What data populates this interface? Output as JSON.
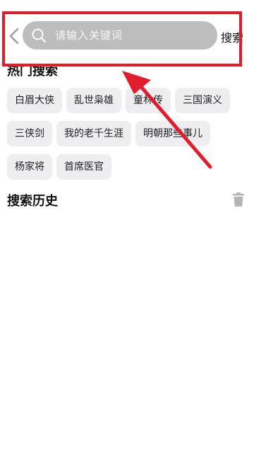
{
  "search": {
    "placeholder": "请输入关键词",
    "button_label": "搜索"
  },
  "hot": {
    "title": "热门搜索",
    "tags": [
      "白眉大侠",
      "乱世枭雄",
      "童林传",
      "三国演义",
      "三侠剑",
      "我的老千生涯",
      "明朝那些事儿",
      "杨家将",
      "首席医官"
    ]
  },
  "history": {
    "title": "搜索历史"
  },
  "colors": {
    "annotation": "#e11d2c",
    "tag_bg": "#eeeef1",
    "search_bg": "#bdbdbd"
  },
  "icons": [
    "back-arrow-icon",
    "search-icon",
    "trash-icon"
  ]
}
